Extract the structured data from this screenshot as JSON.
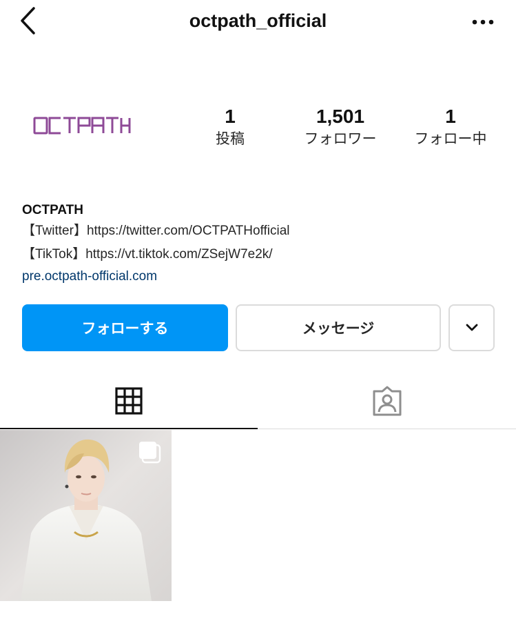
{
  "header": {
    "username": "octpath_official",
    "back_icon": "chevron-left-icon",
    "more_icon": "ellipsis-icon"
  },
  "profile": {
    "logo_text": "OCTPATH",
    "logo_color": "#8e4a97",
    "stats": {
      "posts": {
        "value": "1",
        "label": "投稿"
      },
      "followers": {
        "value": "1,501",
        "label": "フォロワー"
      },
      "following": {
        "value": "1",
        "label": "フォロー中"
      }
    }
  },
  "bio": {
    "name": "OCTPATH",
    "lines": [
      "【Twitter】https://twitter.com/OCTPATHofficial",
      "【TikTok】https://vt.tiktok.com/ZSejW7e2k/"
    ],
    "link": "pre.octpath-official.com"
  },
  "actions": {
    "follow_label": "フォローする",
    "message_label": "メッセージ",
    "more_icon": "chevron-down-icon",
    "follow_color": "#0095f6"
  },
  "tabs": [
    {
      "name": "grid",
      "icon": "grid-icon",
      "active": true
    },
    {
      "name": "tagged",
      "icon": "tagged-person-icon",
      "active": false
    }
  ],
  "posts": [
    {
      "type": "carousel",
      "icon": "multiple-posts-icon"
    }
  ]
}
